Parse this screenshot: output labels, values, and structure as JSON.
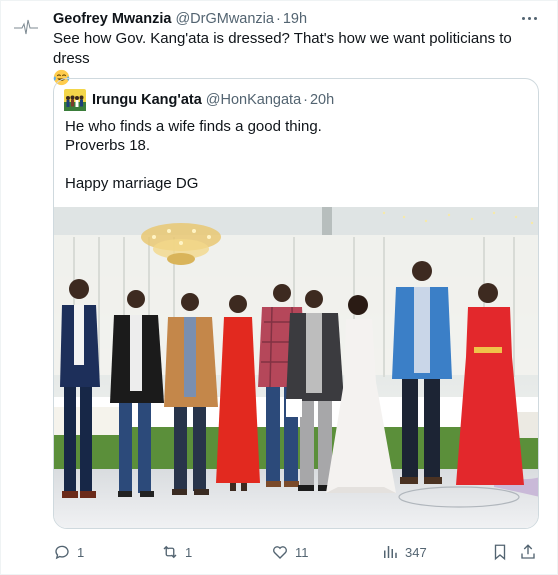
{
  "tweet": {
    "author_name": "Geofrey Mwanzia",
    "author_handle": "@DrGMwanzia",
    "separator": "·",
    "time": "19h",
    "text": "See how Gov. Kang'ata is dressed? That's how we want politicians to dress",
    "emoji_icon": "laughing-tears-emoji",
    "avatar_icon": "ecg-heartbeat-avatar"
  },
  "quote": {
    "author_name": "Irungu Kang'ata",
    "author_handle": "@HonKangata",
    "separator": "·",
    "time": "20h",
    "lines": [
      "He who finds a wife finds a good thing.",
      "Proverbs 18.",
      "",
      "Happy marriage DG"
    ],
    "avatar_icon": "group-photo-avatar"
  },
  "actions": {
    "reply_count": "1",
    "retweet_count": "1",
    "like_count": "11",
    "views_count": "347"
  },
  "colors": {
    "text_primary": "#0f1419",
    "text_secondary": "#536471",
    "border": "#cfd9de"
  }
}
